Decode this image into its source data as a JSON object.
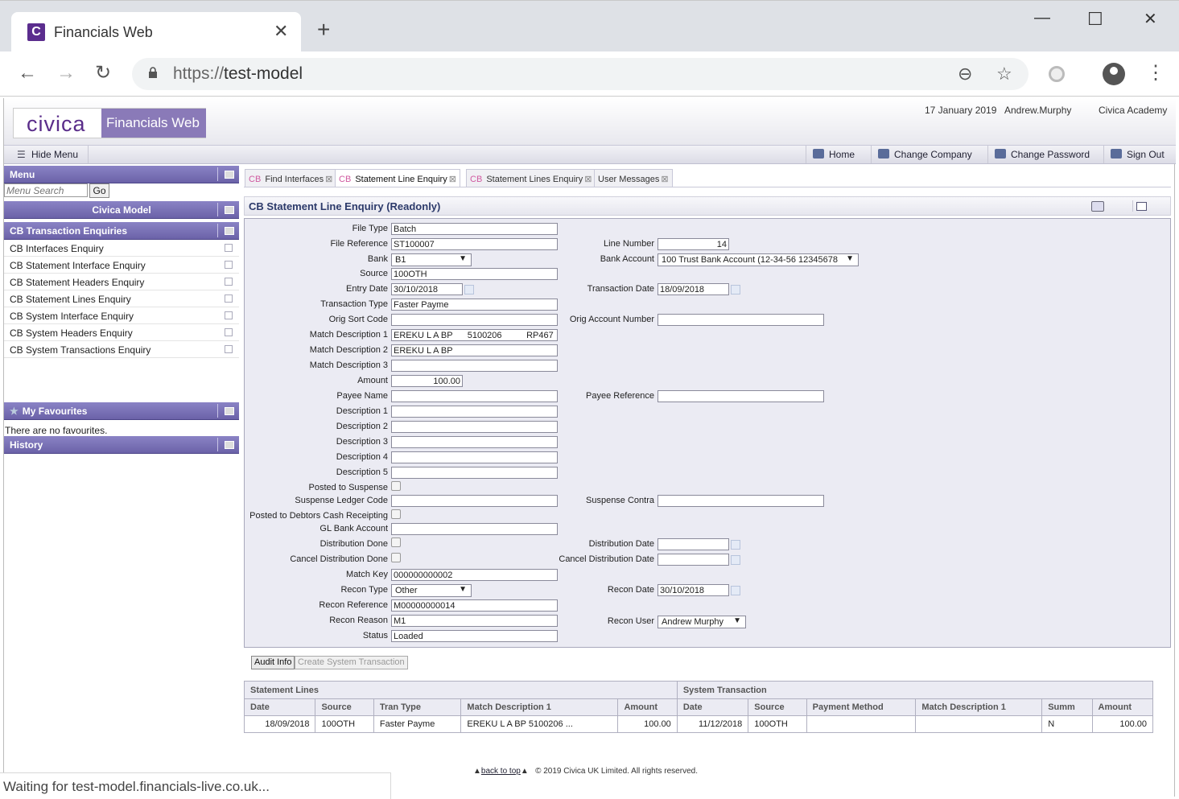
{
  "browser": {
    "tab_title": "Financials Web",
    "tab_favicon": "C",
    "close_tab": "✕",
    "new_tab": "+",
    "url_scheme": "https://",
    "url_host": "test-model",
    "minimize": "—",
    "maximize": "☐",
    "close_window": "✕",
    "back": "←",
    "forward": "→",
    "reload": "↻",
    "zoom": "⊖",
    "star": "☆",
    "kebab": "⋮",
    "status": "Waiting for test-model.financials-live.co.uk..."
  },
  "header": {
    "logo_text": "civica",
    "product": "Financials Web",
    "date": "17 January 2019",
    "user": "Andrew.Murphy",
    "org": "Civica Academy"
  },
  "menubar": {
    "hide_menu": "Hide Menu",
    "home": "Home",
    "change_company": "Change Company",
    "change_password": "Change Password",
    "sign_out": "Sign Out"
  },
  "sidebar": {
    "menu_title": "Menu",
    "search_placeholder": "Menu Search",
    "go": "Go",
    "model_title": "Civica Model",
    "section_title": "CB Transaction Enquiries",
    "items": [
      {
        "label": "CB Interfaces Enquiry"
      },
      {
        "label": "CB Statement Interface Enquiry"
      },
      {
        "label": "CB Statement Headers Enquiry"
      },
      {
        "label": "CB Statement Lines Enquiry"
      },
      {
        "label": "CB System Interface Enquiry"
      },
      {
        "label": "CB System Headers Enquiry"
      },
      {
        "label": "CB System Transactions Enquiry"
      }
    ],
    "favourites_title": "My Favourites",
    "no_favourites": "There are no favourites.",
    "history_title": "History"
  },
  "tabs": [
    {
      "prefix": "CB",
      "label": "Find Interfaces",
      "close": "⊠"
    },
    {
      "prefix": "CB",
      "label": "Statement Line Enquiry",
      "close": "⊠"
    },
    {
      "prefix": "CB",
      "label": "Statement Lines Enquiry",
      "close": "⊠"
    },
    {
      "prefix": "",
      "label": "User Messages",
      "close": "⊠"
    }
  ],
  "form": {
    "title": "CB Statement Line Enquiry (Readonly)",
    "labels": {
      "file_type": "File Type",
      "file_reference": "File Reference",
      "bank": "Bank",
      "source": "Source",
      "entry_date": "Entry Date",
      "transaction_type": "Transaction Type",
      "orig_sort_code": "Orig Sort Code",
      "match_desc_1": "Match Description 1",
      "match_desc_2": "Match Description 2",
      "match_desc_3": "Match Description 3",
      "amount": "Amount",
      "payee_name": "Payee Name",
      "desc_1": "Description 1",
      "desc_2": "Description 2",
      "desc_3": "Description 3",
      "desc_4": "Description 4",
      "desc_5": "Description 5",
      "posted_to_suspense": "Posted to Suspense",
      "suspense_ledger_code": "Suspense Ledger Code",
      "posted_to_debtors": "Posted to Debtors Cash Receipting",
      "gl_bank_account": "GL Bank Account",
      "distribution_done": "Distribution Done",
      "cancel_distribution_done": "Cancel Distribution Done",
      "match_key": "Match Key",
      "recon_type": "Recon Type",
      "recon_reference": "Recon Reference",
      "recon_reason": "Recon Reason",
      "status": "Status",
      "line_number": "Line Number",
      "bank_account": "Bank Account",
      "transaction_date": "Transaction Date",
      "orig_account_number": "Orig Account Number",
      "payee_reference": "Payee Reference",
      "suspense_contra": "Suspense Contra",
      "distribution_date": "Distribution Date",
      "cancel_distribution_date": "Cancel Distribution Date",
      "recon_date": "Recon Date",
      "recon_user": "Recon User"
    },
    "values": {
      "file_type": "Batch",
      "file_reference": "ST100007",
      "bank": "B1",
      "source": "100OTH",
      "entry_date": "30/10/2018",
      "transaction_type": "Faster Payme",
      "orig_sort_code": "",
      "match_desc_1": "EREKU L A BP      5100206          RP467",
      "match_desc_2": "EREKU L A BP",
      "match_desc_3": "",
      "amount": "100.00",
      "payee_name": "",
      "desc_1": "",
      "desc_2": "",
      "desc_3": "",
      "desc_4": "",
      "desc_5": "",
      "suspense_ledger_code": "",
      "gl_bank_account": "",
      "match_key": "000000000002",
      "recon_type": "Other",
      "recon_reference": "M00000000014",
      "recon_reason": "M1",
      "status": "Loaded",
      "line_number": "14",
      "bank_account": "100 Trust Bank Account (12-34-56 12345678",
      "transaction_date": "18/09/2018",
      "orig_account_number": "",
      "payee_reference": "",
      "suspense_contra": "",
      "distribution_date": "",
      "cancel_distribution_date": "",
      "recon_date": "30/10/2018",
      "recon_user": "Andrew Murphy"
    },
    "checkboxes": {
      "posted_to_suspense": false,
      "posted_to_debtors": false,
      "distribution_done": false,
      "cancel_distribution_done": false
    }
  },
  "buttons": {
    "audit_info": "Audit Info",
    "create_system_transaction": "Create System Transaction"
  },
  "table": {
    "group_headers": [
      "Statement Lines",
      "System Transaction"
    ],
    "columns": [
      "Date",
      "Source",
      "Tran Type",
      "Match Description 1",
      "Amount",
      "Date",
      "Source",
      "Payment Method",
      "Match Description 1",
      "Summ",
      "Amount"
    ],
    "rows": [
      [
        "18/09/2018",
        "100OTH",
        "Faster Payme",
        "EREKU L A BP 5100206 ...",
        "100.00",
        "11/12/2018",
        "100OTH",
        "",
        "",
        "N",
        "100.00"
      ]
    ]
  },
  "footer": {
    "back_to_top": "back to top",
    "copyright": "© 2019 Civica UK Limited. All rights reserved."
  }
}
